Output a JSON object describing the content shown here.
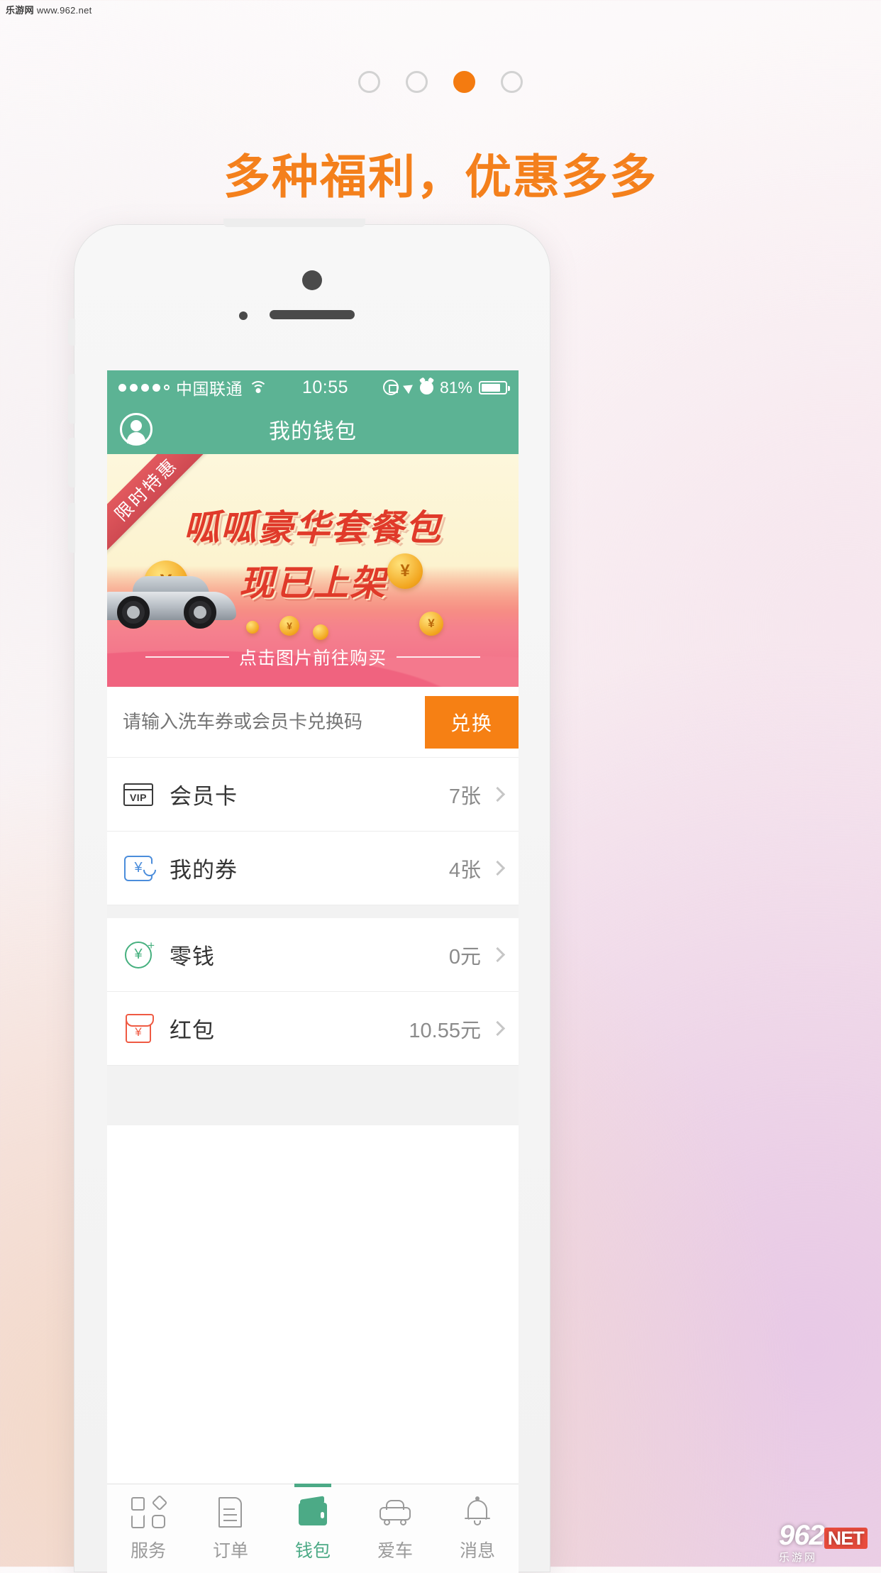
{
  "watermark": {
    "site_cn": "乐游网",
    "site_url": "www.962.net"
  },
  "footer_watermark": {
    "big": "962",
    "net": "NET",
    "sub": "乐游网"
  },
  "promo": {
    "headline": "多种福利，优惠多多",
    "pager": {
      "count": 4,
      "active_index": 2
    }
  },
  "phone": {
    "statusbar": {
      "signal_filled": 4,
      "signal_empty": 1,
      "carrier": "中国联通",
      "wifi_icon": "wifi-icon",
      "time": "10:55",
      "rotation_lock_icon": "rotation-lock-icon",
      "location_icon": "location-arrow-icon",
      "alarm_icon": "alarm-clock-icon",
      "battery_percent": "81%",
      "battery_icon": "battery-icon"
    },
    "navbar": {
      "avatar_icon": "user-avatar-icon",
      "title": "我的钱包"
    },
    "banner": {
      "ribbon": "限时特惠",
      "title_line1": "呱呱豪华套餐包",
      "title_line2": "现已上架",
      "cta": "点击图片前往购买",
      "coin_symbol": "¥"
    },
    "exchange": {
      "placeholder": "请输入洗车券或会员卡兑换码",
      "value": "",
      "button_label": "兑换",
      "button_color": "#f68014"
    },
    "list": [
      {
        "icon": "vip-card-icon",
        "icon_text": "VIP",
        "label": "会员卡",
        "value": "7张",
        "icon_color": "#3a3a3a"
      },
      {
        "icon": "coupon-ticket-icon",
        "icon_text": "¥",
        "label": "我的券",
        "value": "4张",
        "icon_color": "#4b8ddb"
      },
      {
        "icon": "coin-plus-icon",
        "icon_text": "¥",
        "label": "零钱",
        "value": "0元",
        "icon_color": "#46b07f"
      },
      {
        "icon": "red-packet-icon",
        "icon_text": "¥",
        "label": "红包",
        "value": "10.55元",
        "icon_color": "#ef5a43"
      }
    ],
    "tabbar": {
      "active_index": 2,
      "active_color": "#4caa86",
      "items": [
        {
          "icon": "service-grid-icon",
          "label": "服务"
        },
        {
          "icon": "order-document-icon",
          "label": "订单"
        },
        {
          "icon": "wallet-icon",
          "label": "钱包"
        },
        {
          "icon": "car-icon",
          "label": "爱车"
        },
        {
          "icon": "bell-icon",
          "label": "消息"
        }
      ]
    }
  }
}
